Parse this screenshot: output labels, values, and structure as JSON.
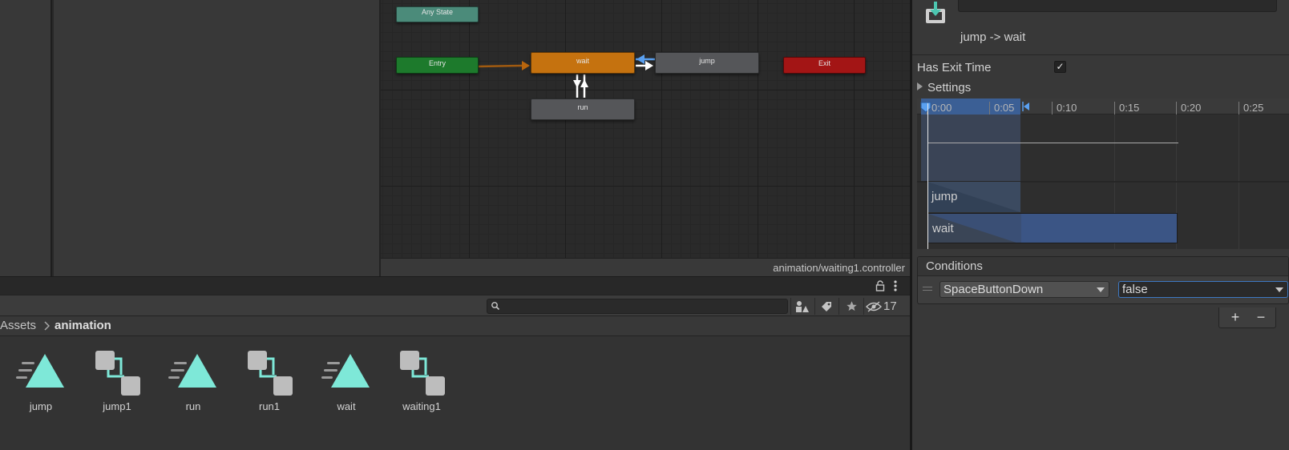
{
  "graph": {
    "nodes": {
      "any_state": "Any State",
      "entry": "Entry",
      "wait": "wait",
      "jump": "jump",
      "exit": "Exit",
      "run": "run"
    },
    "status_path": "animation/waiting1.controller"
  },
  "project": {
    "toolbar": {
      "search_placeholder": "",
      "hidden_count": "17",
      "icons": [
        "search-icon",
        "type-filter-icon",
        "label-filter-icon",
        "favorite-star-icon",
        "hidden-eye-icon"
      ]
    },
    "tab_icons": [
      "lock-icon",
      "kebab-menu-icon"
    ],
    "breadcrumb": {
      "root": "Assets",
      "current": "animation"
    },
    "assets": [
      {
        "name": "jump",
        "kind": "animation-clip-icon"
      },
      {
        "name": "jump1",
        "kind": "animator-controller-icon"
      },
      {
        "name": "run",
        "kind": "animation-clip-icon"
      },
      {
        "name": "run1",
        "kind": "animator-controller-icon"
      },
      {
        "name": "wait",
        "kind": "animation-clip-icon"
      },
      {
        "name": "waiting1",
        "kind": "animator-controller-icon"
      }
    ]
  },
  "inspector": {
    "transition_title": "jump -> wait",
    "has_exit_time_label": "Has Exit Time",
    "has_exit_time_checked": true,
    "check_glyph": "✓",
    "settings_label": "Settings",
    "timeline": {
      "ticks": [
        "0:00",
        "0:05",
        "0:10",
        "0:15",
        "0:20",
        "0:25"
      ],
      "clips": {
        "from": "jump",
        "to": "wait"
      }
    },
    "conditions": {
      "header": "Conditions",
      "parameter": "SpaceButtonDown",
      "value": "false",
      "add_glyph": "+",
      "remove_glyph": "−"
    }
  },
  "colors": {
    "any_state": "#4b8b7a",
    "entry": "#1d7a2c",
    "exit": "#a31515",
    "default_state": "#c5720f",
    "state": "#555659",
    "selected_transition": "#5aa0f0",
    "asset_icon": "#7ee8d8"
  }
}
